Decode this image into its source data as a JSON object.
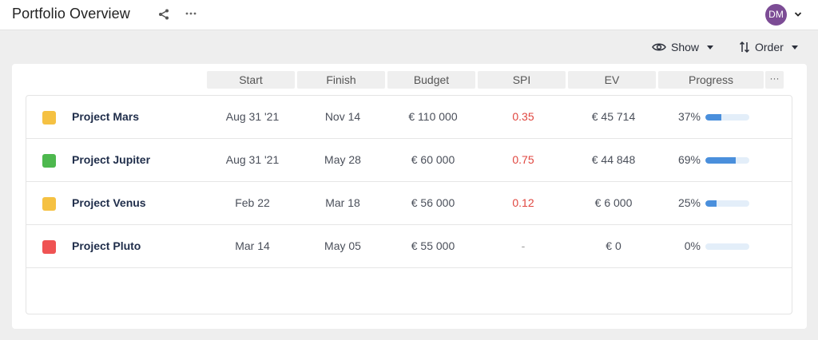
{
  "header": {
    "title": "Portfolio Overview",
    "avatar_initials": "DM",
    "avatar_color": "#7c4c95"
  },
  "toolbar": {
    "show_label": "Show",
    "order_label": "Order"
  },
  "columns": [
    "Start",
    "Finish",
    "Budget",
    "SPI",
    "EV",
    "Progress"
  ],
  "columns_more": "···",
  "projects": [
    {
      "name": "Project Mars",
      "color": "#f5c142",
      "start": "Aug 31 '21",
      "finish": "Nov 14",
      "budget": "€ 110 000",
      "spi": "0.35",
      "ev": "€ 45 714",
      "progress_label": "37%",
      "progress": 0.37
    },
    {
      "name": "Project Jupiter",
      "color": "#4db84e",
      "start": "Aug 31 '21",
      "finish": "May 28",
      "budget": "€ 60 000",
      "spi": "0.75",
      "ev": "€ 44 848",
      "progress_label": "69%",
      "progress": 0.69
    },
    {
      "name": "Project Venus",
      "color": "#f5c142",
      "start": "Feb 22",
      "finish": "Mar 18",
      "budget": "€ 56 000",
      "spi": "0.12",
      "ev": "€ 6 000",
      "progress_label": "25%",
      "progress": 0.25
    },
    {
      "name": "Project Pluto",
      "color": "#ef5353",
      "start": "Mar 14",
      "finish": "May 05",
      "budget": "€ 55 000",
      "spi": "-",
      "ev": "€ 0",
      "progress_label": "0%",
      "progress": 0
    }
  ],
  "icons": {
    "share": "share-icon",
    "more": "more-horizontal-icon",
    "show": "eye-icon",
    "order": "sort-arrows-icon",
    "avatar_caret": "chevron-down-icon"
  }
}
